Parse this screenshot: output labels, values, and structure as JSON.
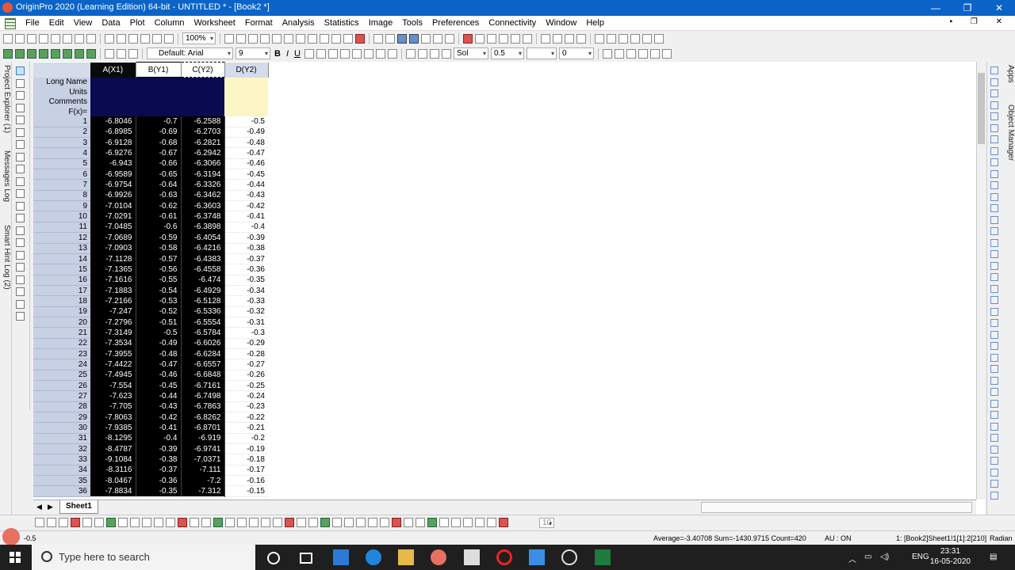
{
  "window": {
    "title": "OriginPro 2020 (Learning Edition) 64-bit - UNTITLED * - [Book2 *]",
    "controls": [
      "—",
      "❐",
      "✕"
    ]
  },
  "menu": [
    "File",
    "Edit",
    "View",
    "Data",
    "Plot",
    "Column",
    "Worksheet",
    "Format",
    "Analysis",
    "Statistics",
    "Image",
    "Tools",
    "Preferences",
    "Connectivity",
    "Window",
    "Help"
  ],
  "toolbar": {
    "zoom": "100%",
    "font": "Default: Arial",
    "font_size": "9",
    "bold": "B",
    "italic": "I",
    "underline": "U",
    "line_style": "Sol",
    "line_width": "0.5",
    "angle": "0",
    "bottom_size": "10"
  },
  "left_tabs": [
    "Project Explorer (1)",
    "Messages Log",
    "Smart Hint Log (2)"
  ],
  "right_tabs": [
    "Apps",
    "Object Manager"
  ],
  "worksheet": {
    "columns": [
      {
        "name": "A(X1)",
        "selected": true
      },
      {
        "name": "B(Y1)",
        "selected": true
      },
      {
        "name": "C(Y2)",
        "selected": true
      },
      {
        "name": "D(Y2)",
        "selected": false
      }
    ],
    "meta_labels": [
      "Long Name",
      "Units",
      "Comments",
      "F(x)="
    ],
    "rows": [
      [
        1,
        "-6.8046",
        "-0.7",
        "-6.2588",
        "-0.5"
      ],
      [
        2,
        "-6.8985",
        "-0.69",
        "-6.2703",
        "-0.49"
      ],
      [
        3,
        "-6.9128",
        "-0.68",
        "-6.2821",
        "-0.48"
      ],
      [
        4,
        "-6.9276",
        "-0.67",
        "-6.2942",
        "-0.47"
      ],
      [
        5,
        "-6.943",
        "-0.66",
        "-6.3066",
        "-0.46"
      ],
      [
        6,
        "-6.9589",
        "-0.65",
        "-6.3194",
        "-0.45"
      ],
      [
        7,
        "-6.9754",
        "-0.64",
        "-6.3326",
        "-0.44"
      ],
      [
        8,
        "-6.9926",
        "-0.63",
        "-6.3462",
        "-0.43"
      ],
      [
        9,
        "-7.0104",
        "-0.62",
        "-6.3603",
        "-0.42"
      ],
      [
        10,
        "-7.0291",
        "-0.61",
        "-6.3748",
        "-0.41"
      ],
      [
        11,
        "-7.0485",
        "-0.6",
        "-6.3898",
        "-0.4"
      ],
      [
        12,
        "-7.0689",
        "-0.59",
        "-6.4054",
        "-0.39"
      ],
      [
        13,
        "-7.0903",
        "-0.58",
        "-6.4216",
        "-0.38"
      ],
      [
        14,
        "-7.1128",
        "-0.57",
        "-6.4383",
        "-0.37"
      ],
      [
        15,
        "-7.1365",
        "-0.56",
        "-6.4558",
        "-0.36"
      ],
      [
        16,
        "-7.1616",
        "-0.55",
        "-6.474",
        "-0.35"
      ],
      [
        17,
        "-7.1883",
        "-0.54",
        "-6.4929",
        "-0.34"
      ],
      [
        18,
        "-7.2166",
        "-0.53",
        "-6.5128",
        "-0.33"
      ],
      [
        19,
        "-7.247",
        "-0.52",
        "-6.5336",
        "-0.32"
      ],
      [
        20,
        "-7.2796",
        "-0.51",
        "-6.5554",
        "-0.31"
      ],
      [
        21,
        "-7.3149",
        "-0.5",
        "-6.5784",
        "-0.3"
      ],
      [
        22,
        "-7.3534",
        "-0.49",
        "-6.6026",
        "-0.29"
      ],
      [
        23,
        "-7.3955",
        "-0.48",
        "-6.6284",
        "-0.28"
      ],
      [
        24,
        "-7.4422",
        "-0.47",
        "-6.6557",
        "-0.27"
      ],
      [
        25,
        "-7.4945",
        "-0.46",
        "-6.6848",
        "-0.26"
      ],
      [
        26,
        "-7.554",
        "-0.45",
        "-6.7161",
        "-0.25"
      ],
      [
        27,
        "-7.623",
        "-0.44",
        "-6.7498",
        "-0.24"
      ],
      [
        28,
        "-7.705",
        "-0.43",
        "-6.7863",
        "-0.23"
      ],
      [
        29,
        "-7.8063",
        "-0.42",
        "-6.8262",
        "-0.22"
      ],
      [
        30,
        "-7.9385",
        "-0.41",
        "-6.8701",
        "-0.21"
      ],
      [
        31,
        "-8.1295",
        "-0.4",
        "-6.919",
        "-0.2"
      ],
      [
        32,
        "-8.4787",
        "-0.39",
        "-6.9741",
        "-0.19"
      ],
      [
        33,
        "-9.1084",
        "-0.38",
        "-7.0371",
        "-0.18"
      ],
      [
        34,
        "-8.3116",
        "-0.37",
        "-7.111",
        "-0.17"
      ],
      [
        35,
        "-8.0467",
        "-0.36",
        "-7.2",
        "-0.16"
      ],
      [
        36,
        "-7.8834",
        "-0.35",
        "-7.312",
        "-0.15"
      ]
    ],
    "sheet_tab": "Sheet1"
  },
  "status": {
    "left_value": "-0.5",
    "stats": "Average=-3.40708 Sum=-1430.9715 Count=420",
    "au": "AU : ON",
    "ref": "1: [Book2]Sheet1!1[1]:2[210]",
    "units": "Radian"
  },
  "taskbar": {
    "search_placeholder": "Type here to search",
    "language": "ENG",
    "time": "23:31",
    "date": "16-05-2020"
  }
}
